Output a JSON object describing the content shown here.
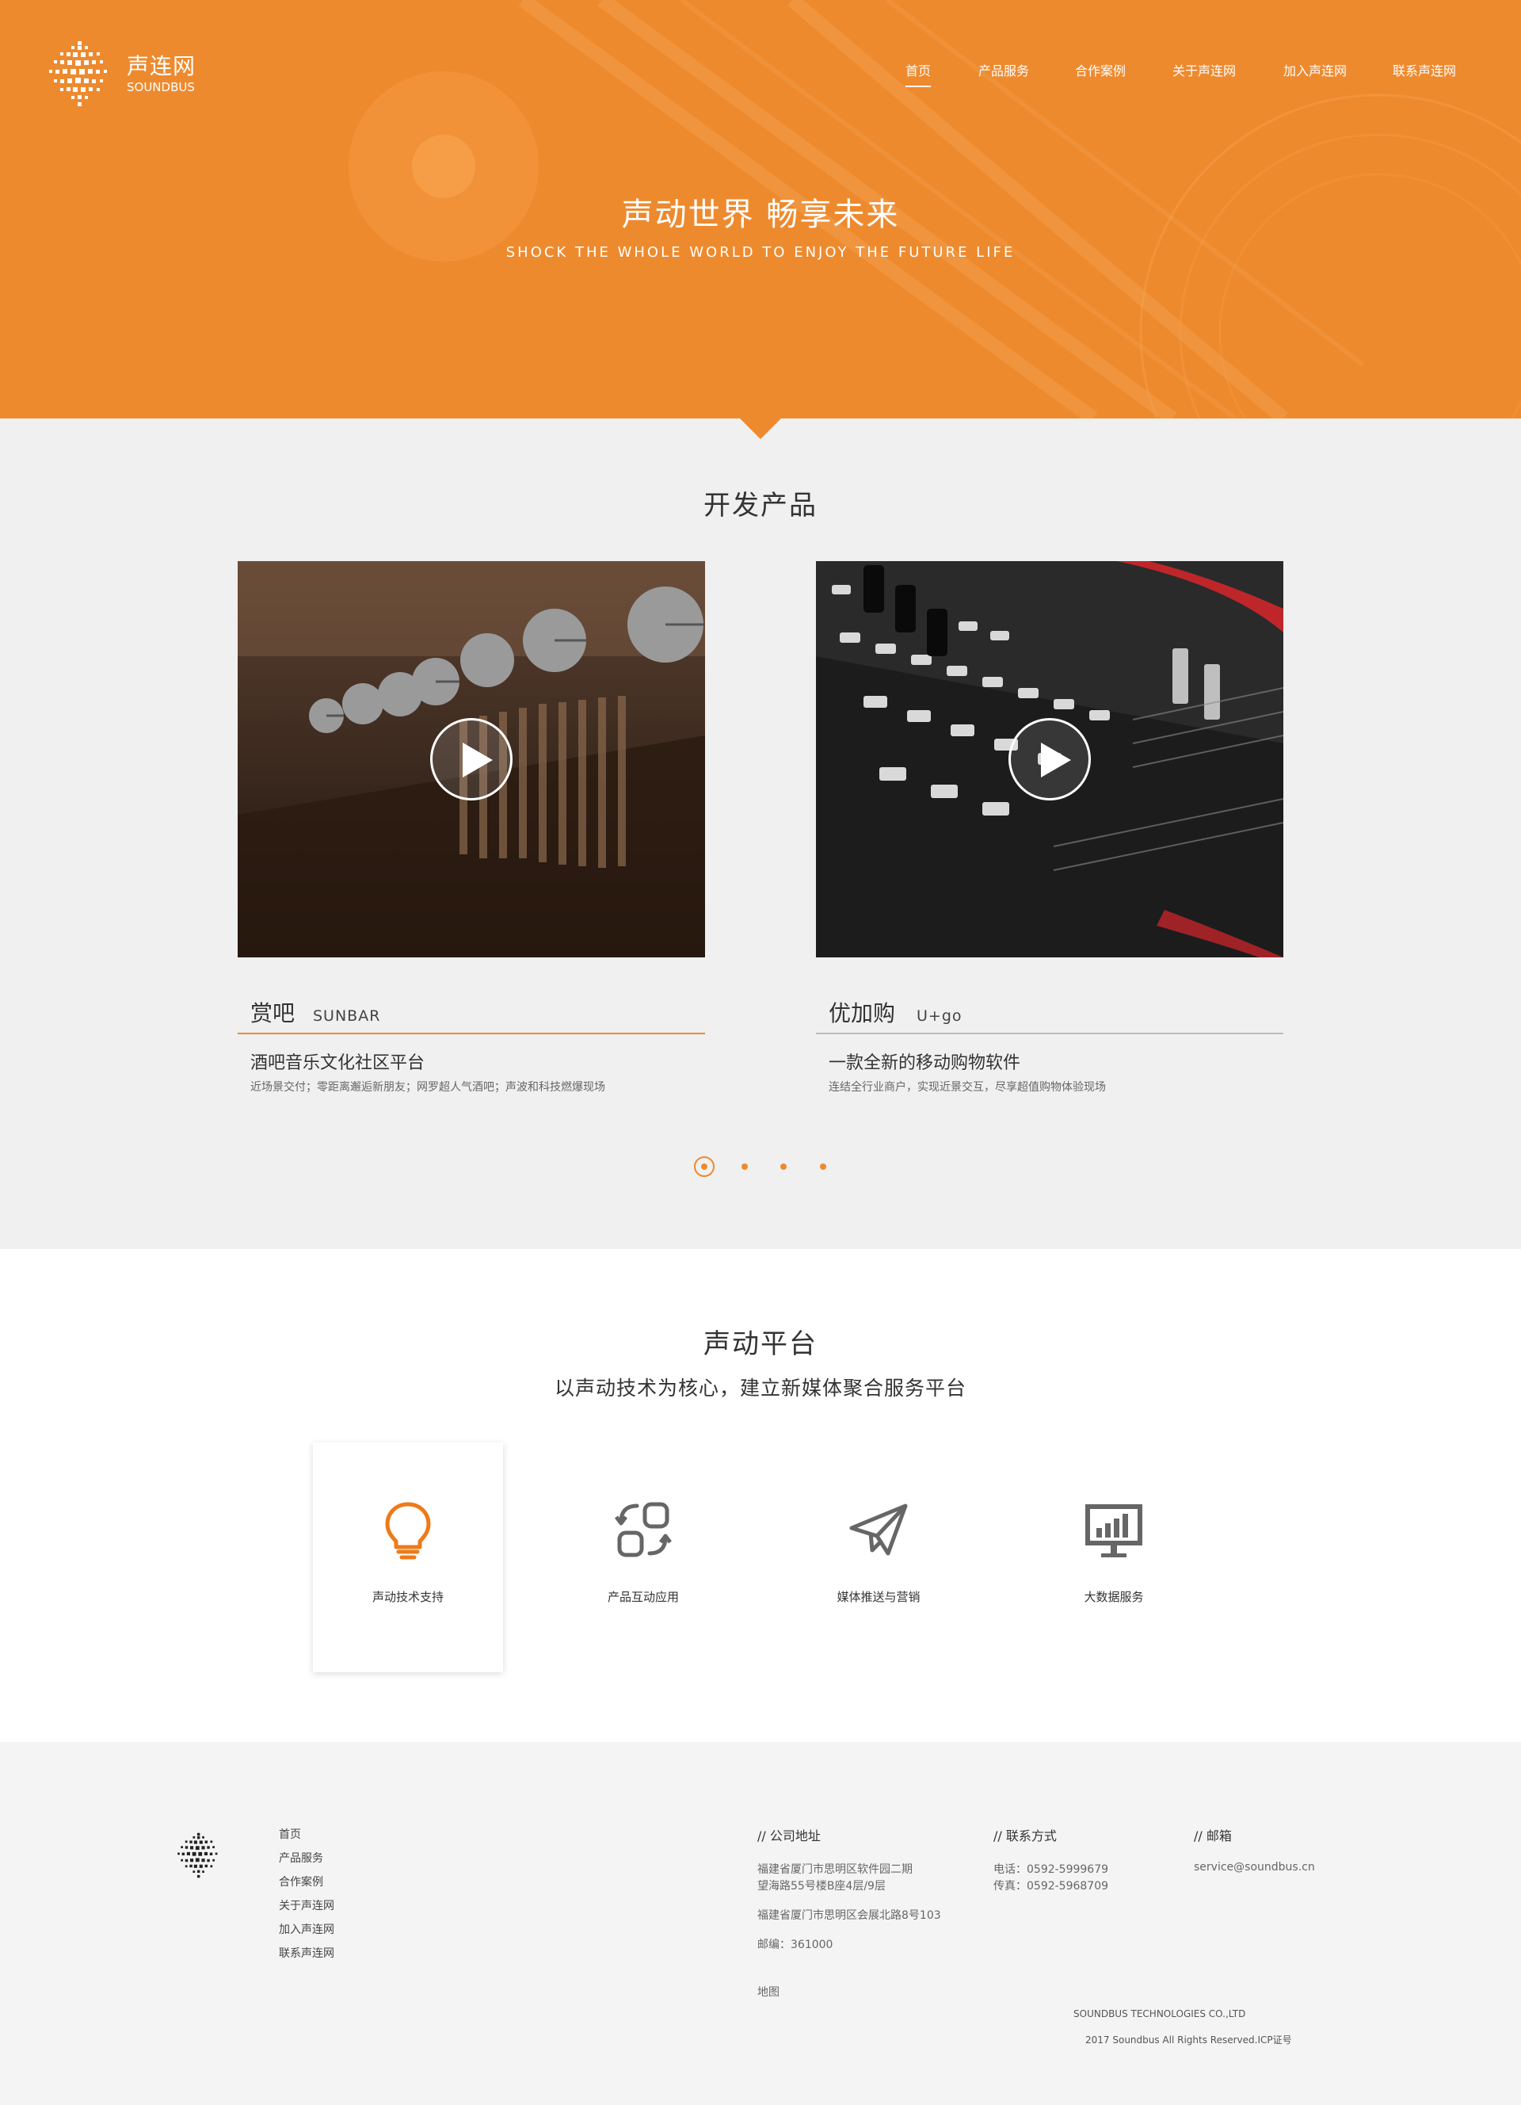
{
  "brand": {
    "name_cn": "声连网",
    "name_en": "SOUNDBUS"
  },
  "nav": {
    "items": [
      "首页",
      "产品服务",
      "合作案例",
      "关于声连网",
      "加入声连网",
      "联系声连网"
    ],
    "active": 0
  },
  "hero": {
    "title": "声动世界 畅享未来",
    "subtitle": "SHOCK THE WHOLE WORLD TO  ENJOY THE FUTURE LIFE"
  },
  "products": {
    "title": "开发产品",
    "cards": [
      {
        "name": "赏吧",
        "name_en": "SUNBAR",
        "desc": "酒吧音乐文化社区平台",
        "sub": "近场景交付；零距离邂逅新朋友；网罗超人气酒吧；声波和科技燃爆现场",
        "image_icon": "bar-scene-image",
        "active": true
      },
      {
        "name": "优加购",
        "name_en": "U+go",
        "desc": "一款全新的移动购物软件",
        "sub": "连结全行业商户，实现近景交互，尽享超值购物体验现场",
        "image_icon": "mixer-console-image",
        "active": false
      }
    ],
    "pagination": {
      "pages": 4,
      "current": 1
    }
  },
  "platform": {
    "title": "声动平台",
    "subtitle": "以声动技术为核心，建立新媒体聚合服务平台",
    "features": [
      {
        "label": "声动技术支持",
        "icon": "lightbulb-icon",
        "active": true
      },
      {
        "label": "产品互动应用",
        "icon": "interaction-icon",
        "active": false
      },
      {
        "label": "媒体推送与营销",
        "icon": "paper-plane-icon",
        "active": false
      },
      {
        "label": "大数据服务",
        "icon": "bar-chart-monitor-icon",
        "active": false
      }
    ]
  },
  "footer": {
    "links": [
      "首页",
      "产品服务",
      "合作案例",
      "关于声连网",
      "加入声连网",
      "联系声连网"
    ],
    "address": {
      "heading": "// 公司地址",
      "line1": "福建省厦门市思明区软件园二期",
      "line2": "望海路55号楼B座4层/9层",
      "line3": "福建省厦门市思明区会展北路8号103",
      "postcode": "邮编：361000",
      "map_link": "地图"
    },
    "contact": {
      "heading": "// 联系方式",
      "phone": "电话：0592-5999679",
      "fax": "传真：0592-5968709"
    },
    "email": {
      "heading": "// 邮箱",
      "address": "service@soundbus.cn"
    },
    "company": "SOUNDBUS TECHNOLOGIES CO.,LTD",
    "copyright": "2017 Soundbus All Rights Reserved.ICP证号"
  },
  "colors": {
    "accent": "#ee8a2e",
    "gray_bg": "#f0f0f0",
    "footer_bg": "#f4f4f4",
    "text": "#333333"
  }
}
